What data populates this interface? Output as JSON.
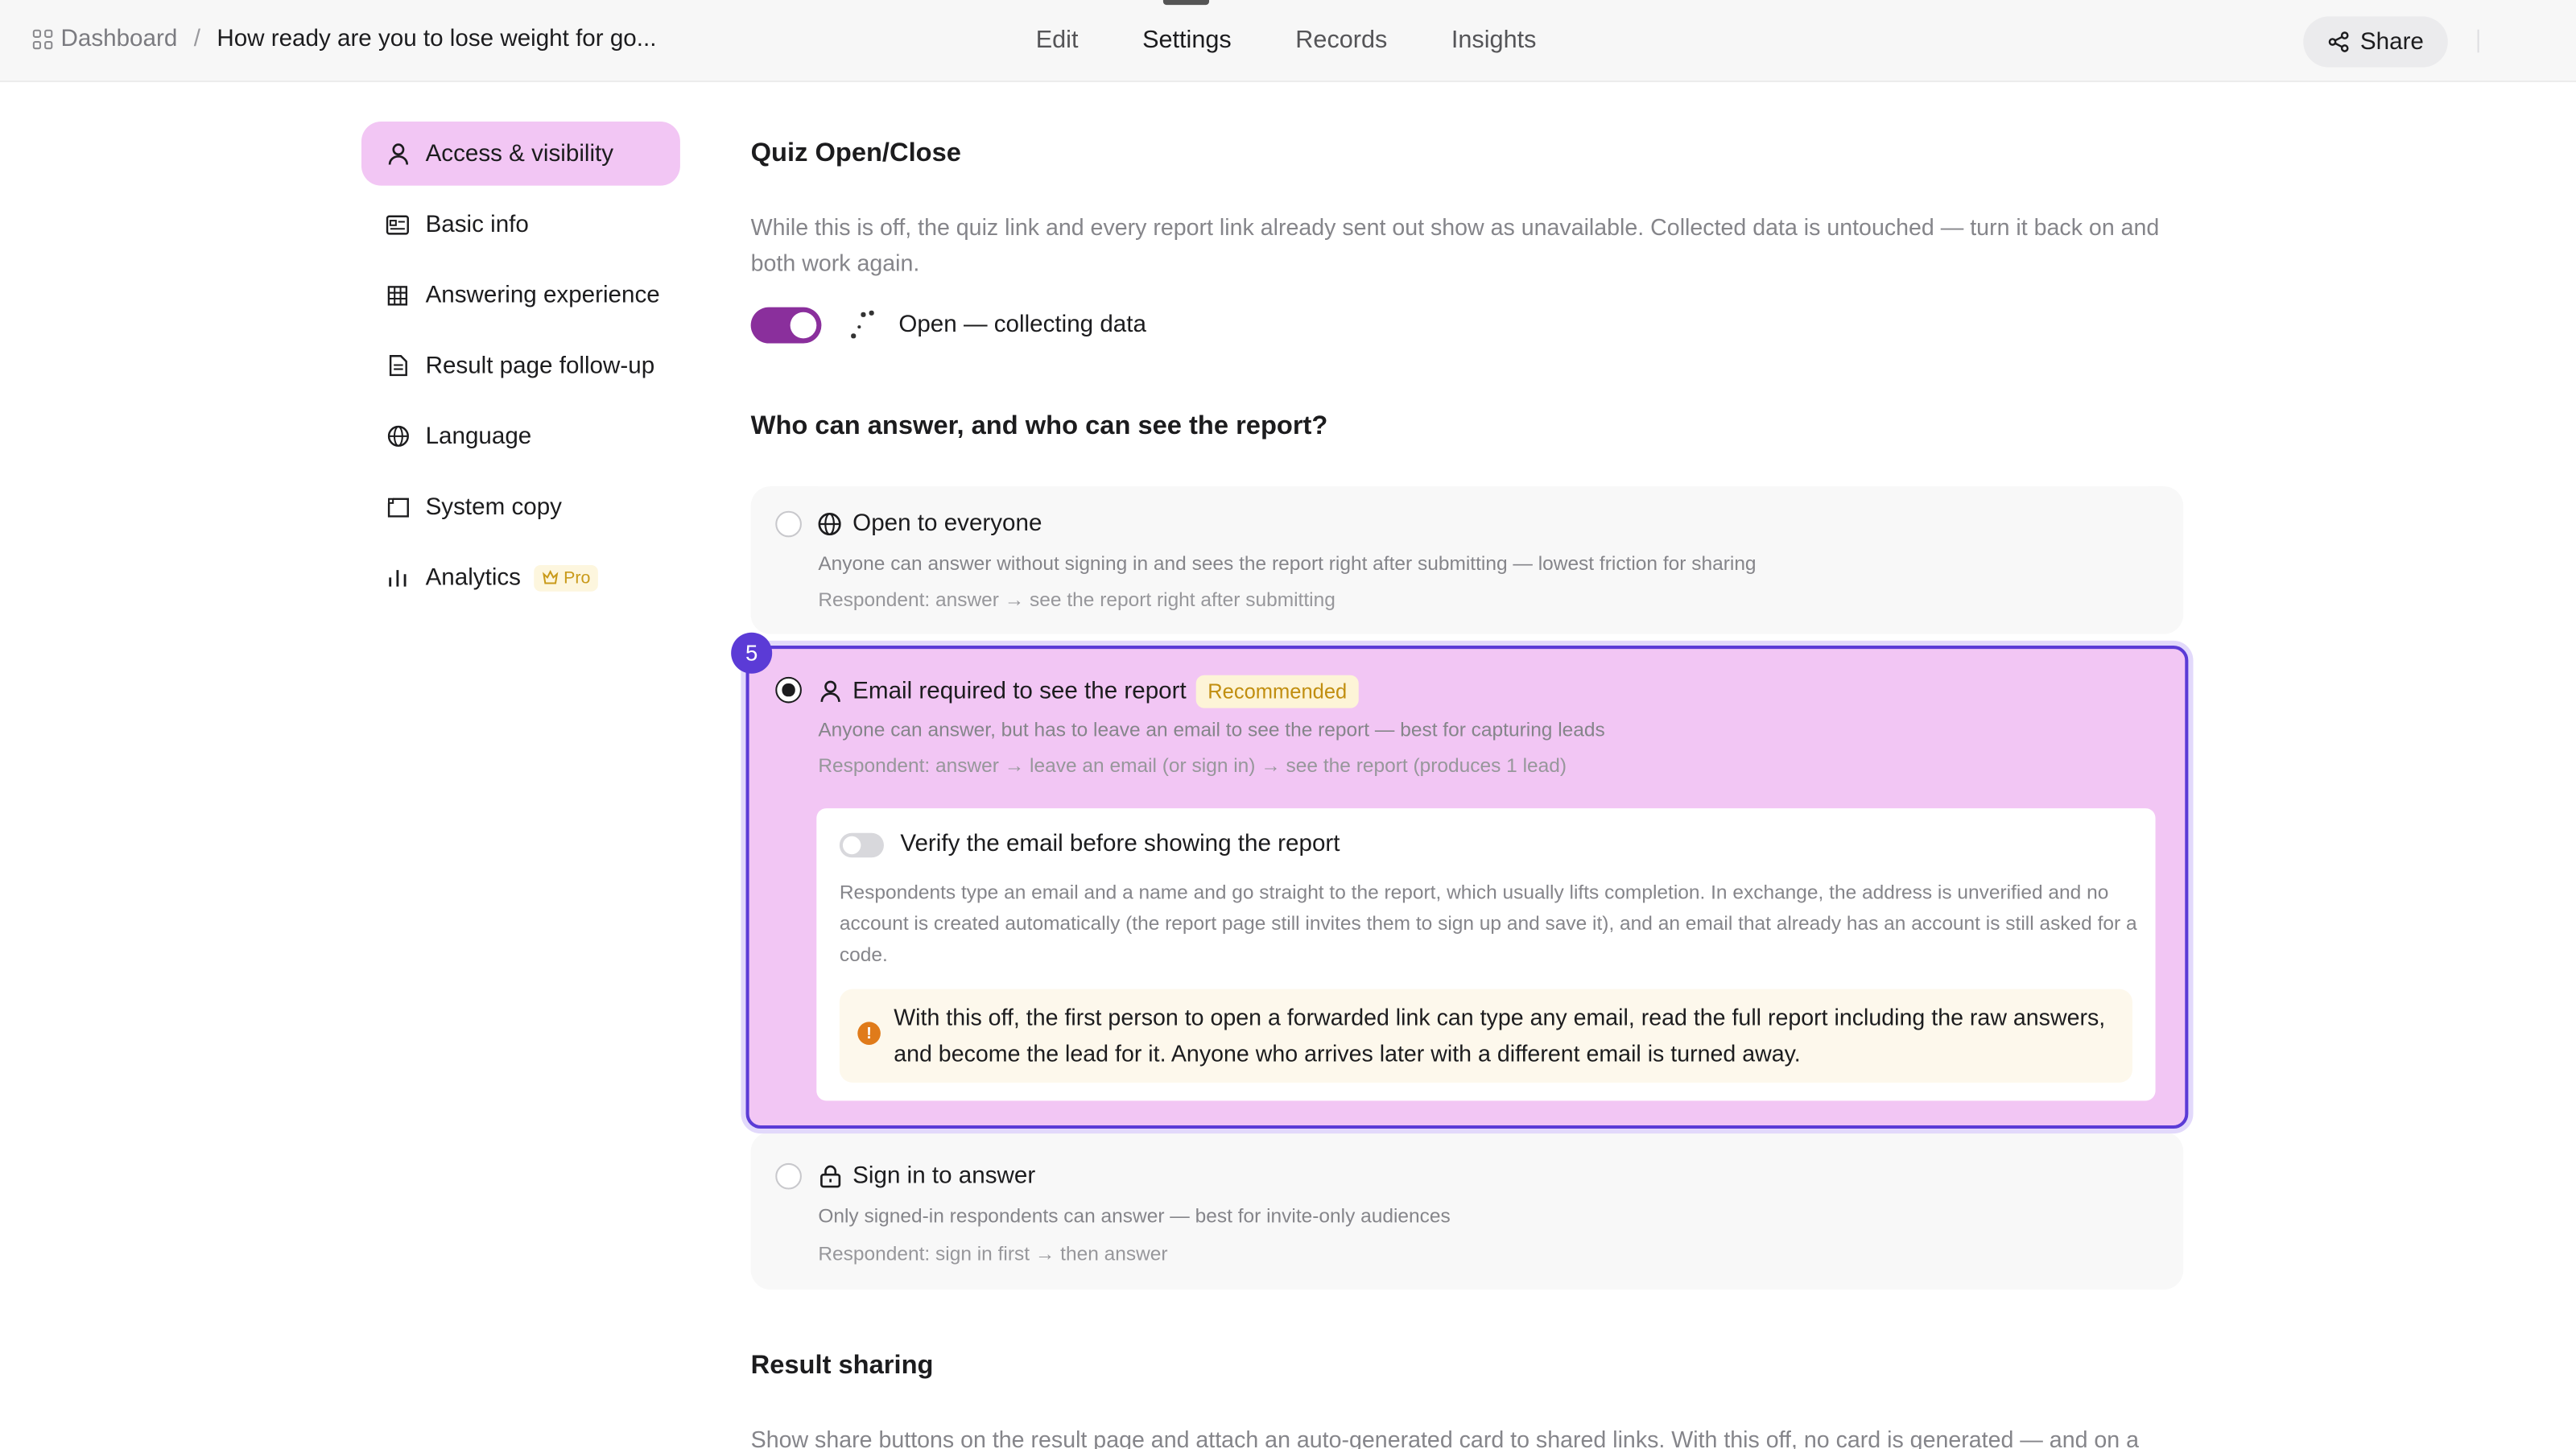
{
  "header": {
    "breadcrumb_root": "Dashboard",
    "breadcrumb_sep": "/",
    "breadcrumb_title": "How ready are you to lose weight for go...",
    "tabs": [
      "Edit",
      "Settings",
      "Records",
      "Insights"
    ],
    "active_tab": "Settings",
    "share_label": "Share"
  },
  "sidebar": {
    "items": [
      {
        "label": "Access & visibility",
        "icon": "person-icon",
        "active": true
      },
      {
        "label": "Basic info",
        "icon": "id-card-icon"
      },
      {
        "label": "Answering experience",
        "icon": "grid-icon"
      },
      {
        "label": "Result page follow-up",
        "icon": "document-icon"
      },
      {
        "label": "Language",
        "icon": "globe-icon"
      },
      {
        "label": "System copy",
        "icon": "copy-frame-icon"
      },
      {
        "label": "Analytics",
        "icon": "bar-chart-icon",
        "badge": "Pro"
      }
    ]
  },
  "quiz_open": {
    "heading": "Quiz Open/Close",
    "description": "While this is off, the quiz link and every report link already sent out show as unavailable. Collected data is untouched — turn it back on and both work again.",
    "toggle_on": true,
    "status": "Open — collecting data"
  },
  "access": {
    "heading": "Who can answer, and who can see the report?",
    "options": [
      {
        "title": "Open to everyone",
        "icon": "globe-icon",
        "line1": "Anyone can answer without signing in and sees the report right after submitting — lowest friction for sharing",
        "line2": "Respondent: answer → see the report right after submitting"
      },
      {
        "title": "Email required to see the report",
        "icon": "person-icon",
        "badge": "Recommended",
        "selected": true,
        "step": "5",
        "line1": "Anyone can answer, but has to leave an email to see the report — best for capturing leads",
        "line2": "Respondent: answer → leave an email (or sign in) → see the report (produces 1 lead)",
        "verify": {
          "title": "Verify the email before showing the report",
          "enabled": false,
          "description": "Respondents type an email and a name and go straight to the report, which usually lifts completion. In exchange, the address is unverified and no account is created automatically (the report page still invites them to sign up and save it), and an email that already has an account is still asked for a code.",
          "warning": "With this off, the first person to open a forwarded link can type any email, read the full report including the raw answers, and become the lead for it. Anyone who arrives later with a different email is turned away."
        }
      },
      {
        "title": "Sign in to answer",
        "icon": "lock-icon",
        "line1": "Only signed-in respondents can answer — best for invite-only audiences",
        "line2": "Respondent: sign in first → then answer"
      }
    ]
  },
  "result_sharing": {
    "heading": "Result sharing",
    "description": "Show share buttons on the result page and attach an auto-generated card to shared links. With this off, no card is generated — and on a"
  },
  "colors": {
    "accent": "#5b3bd6",
    "toggle_on": "#8a2f9c",
    "selected_bg": "#f2c6f4",
    "warning": "#e07b1a"
  }
}
